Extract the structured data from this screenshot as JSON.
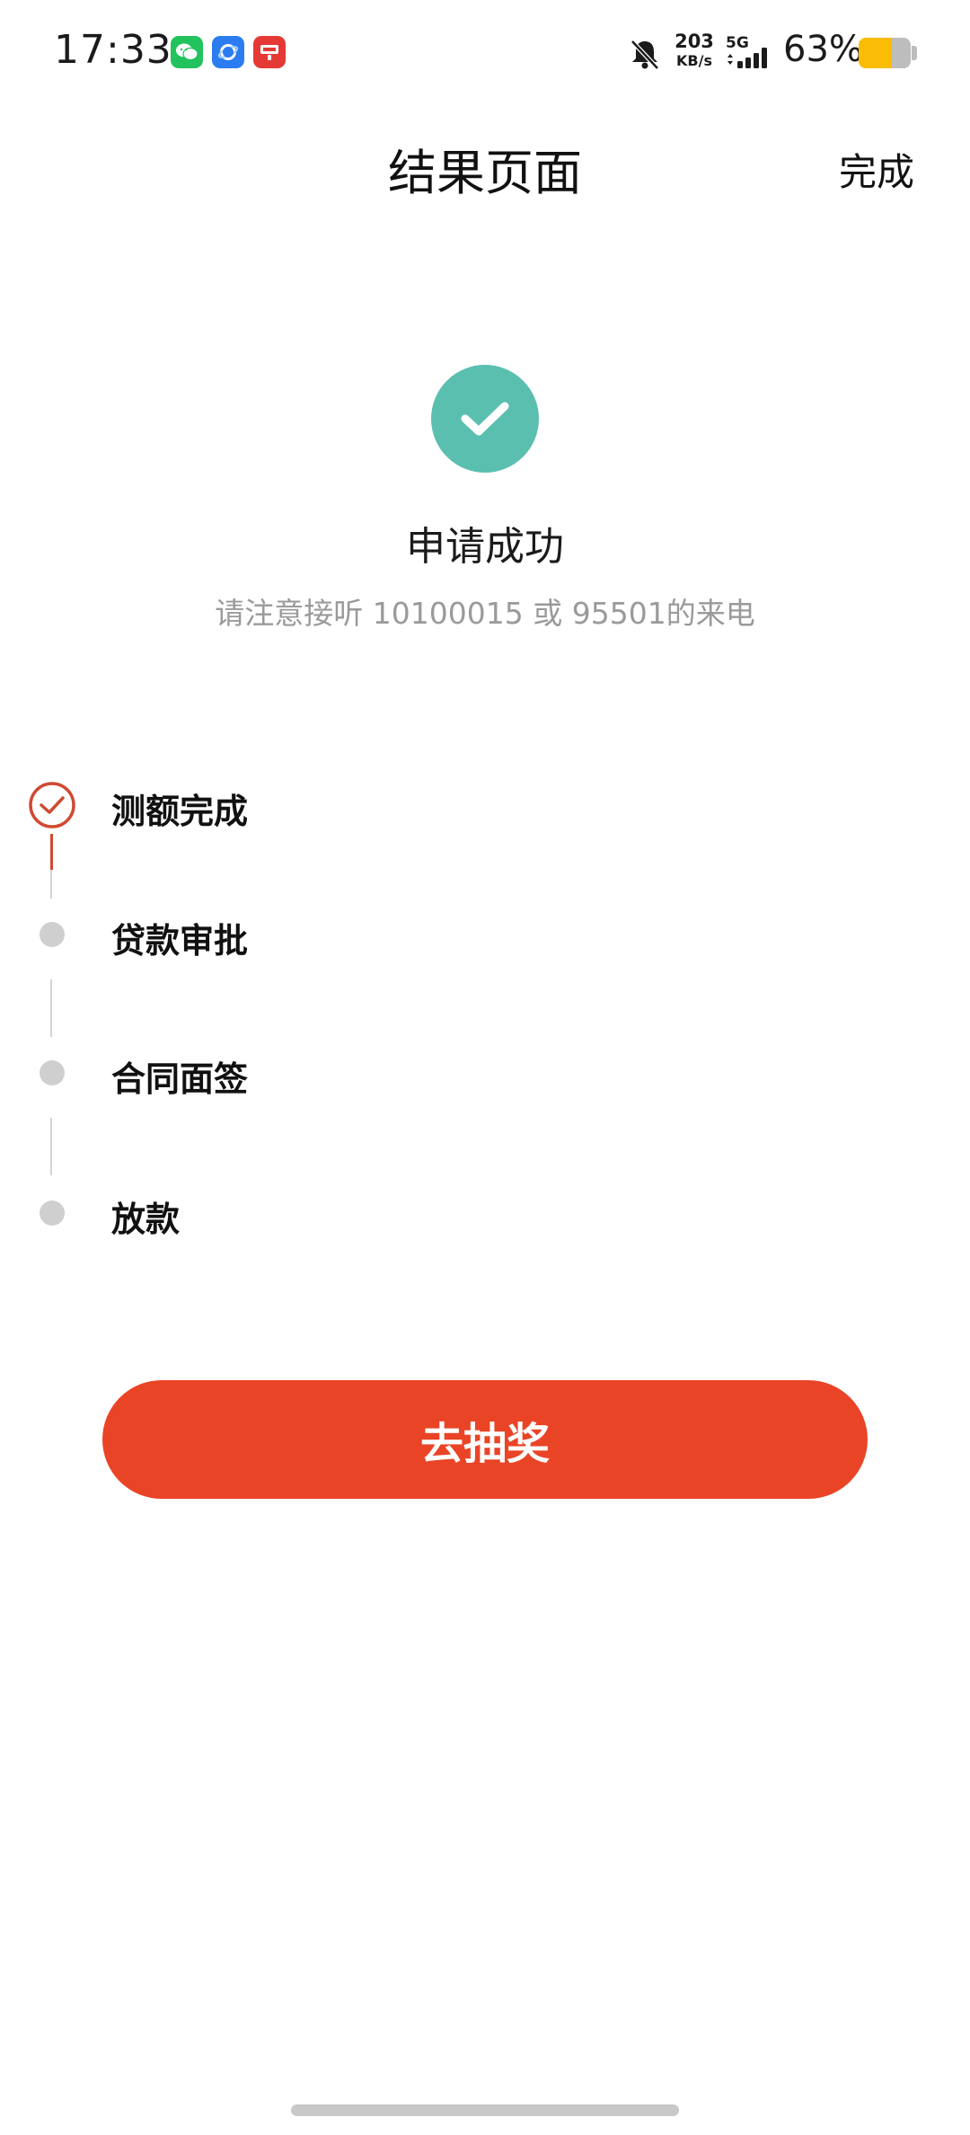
{
  "status_bar": {
    "time": "17:33",
    "apps": [
      "wechat-icon",
      "browser-icon",
      "alipay-icon"
    ],
    "net_speed_value": "203",
    "net_speed_unit": "KB/s",
    "network": "5G",
    "battery_text": "63%",
    "battery_level": 0.63,
    "battery_color": "#fbbc05"
  },
  "nav": {
    "title": "结果页面",
    "done_label": "完成"
  },
  "result": {
    "icon": "check-icon",
    "icon_color": "#5bbfb0",
    "title": "申请成功",
    "subtitle": "请注意接听 10100015 或 95501的来电"
  },
  "steps": [
    {
      "label": "测额完成",
      "status": "done"
    },
    {
      "label": "贷款审批",
      "status": "pending"
    },
    {
      "label": "合同面签",
      "status": "pending"
    },
    {
      "label": "放款",
      "status": "pending"
    }
  ],
  "action": {
    "label": "去抽奖",
    "color": "#ea4426"
  }
}
